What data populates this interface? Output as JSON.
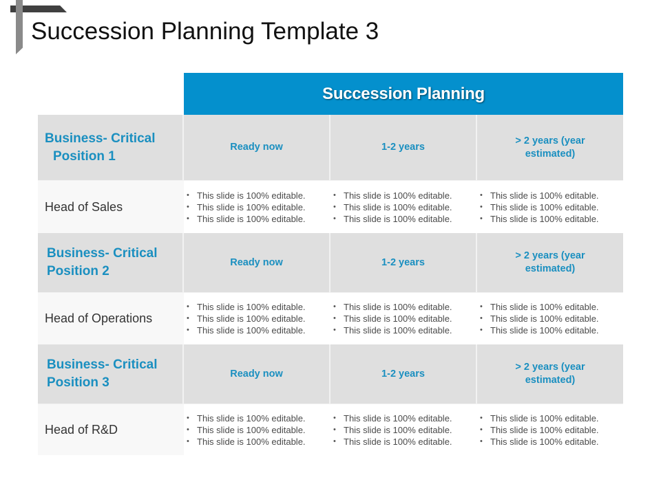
{
  "slide": {
    "title": "Succession Planning Template 3",
    "accent_color": "#0490cd",
    "position_text_color": "#1a8fc0"
  },
  "table": {
    "header": "Succession Planning",
    "columns": [
      "Ready now",
      "1-2 years",
      "> 2 years (year estimated)"
    ],
    "rows": [
      {
        "position_line1": "Business- Critical",
        "position_line2": "Position 1",
        "timeframes": [
          "Ready now",
          "1-2 years",
          "> 2 years (year estimated)"
        ],
        "role": "Head of Sales",
        "cells": [
          [
            "This slide is 100% editable.",
            "This slide is 100% editable.",
            "This slide is 100% editable."
          ],
          [
            "This slide is 100% editable.",
            "This slide is 100% editable.",
            "This slide is 100% editable."
          ],
          [
            "This slide is 100% editable.",
            "This slide is 100% editable.",
            "This slide is 100% editable."
          ]
        ]
      },
      {
        "position_line1": "Business- Critical",
        "position_line2": "Position 2",
        "timeframes": [
          "Ready now",
          "1-2 years",
          "> 2 years (year estimated)"
        ],
        "role": "Head of Operations",
        "cells": [
          [
            "This slide is 100% editable.",
            "This slide is 100% editable.",
            "This slide is 100% editable."
          ],
          [
            "This slide is 100% editable.",
            "This slide is 100% editable.",
            "This slide is 100% editable."
          ],
          [
            "This slide is 100% editable.",
            "This slide is 100% editable.",
            "This slide is 100% editable."
          ]
        ]
      },
      {
        "position_line1": "Business- Critical",
        "position_line2": "Position 3",
        "timeframes": [
          "Ready now",
          "1-2 years",
          "> 2 years (year estimated)"
        ],
        "role": "Head of R&D",
        "cells": [
          [
            "This slide is 100% editable.",
            "This slide is 100% editable.",
            "This slide is 100% editable."
          ],
          [
            "This slide is 100% editable.",
            "This slide is 100% editable.",
            "This slide is 100% editable."
          ],
          [
            "This slide is 100% editable.",
            "This slide is 100% editable.",
            "This slide is 100% editable."
          ]
        ]
      }
    ]
  }
}
